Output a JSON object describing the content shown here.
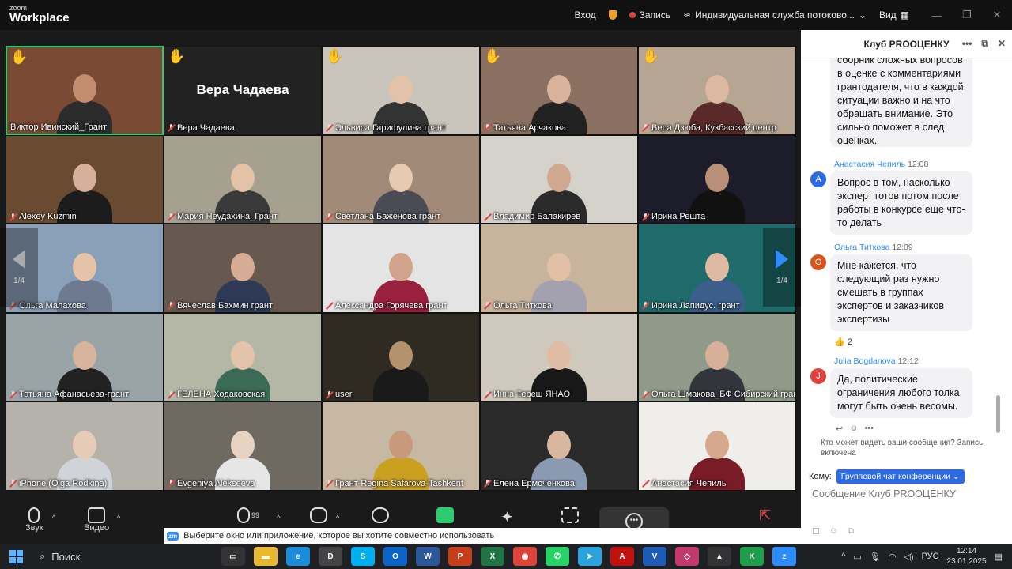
{
  "window": {
    "logo_top": "zoom",
    "logo_bottom": "Workplace",
    "signin": "Вход",
    "record": "Запись",
    "stream": "Индивидуальная служба потоково...",
    "view": "Вид"
  },
  "participants": [
    {
      "name": "Виктор Ивинский_Грант",
      "hand": true,
      "active": true,
      "muted": false,
      "bg": "#7a4a35",
      "skin": "#c28d6e",
      "shirt": "#2c2c2c"
    },
    {
      "name": "Вера Чадаева",
      "hand": true,
      "muted": true,
      "bg": "#222222",
      "big": "Вера Чадаева"
    },
    {
      "name": "Эльвира Гарифулина грант",
      "hand": true,
      "muted": true,
      "bg": "#c9c4bc",
      "skin": "#e2c2a8",
      "shirt": "#333333"
    },
    {
      "name": "Татьяна Арчакова",
      "hand": true,
      "muted": true,
      "bg": "#8a7060",
      "skin": "#d9b39a",
      "shirt": "#222222"
    },
    {
      "name": "Вера Дзюба, Кузбасский центр",
      "hand": true,
      "muted": true,
      "bg": "#b7a593",
      "skin": "#dcb8a0",
      "shirt": "#5a2a2a"
    },
    {
      "name": "Alexey Kuzmin",
      "muted": true,
      "bg": "#6a4a30",
      "skin": "#d6b09a",
      "shirt": "#1c1c1c"
    },
    {
      "name": "Мария Неудахина_Грант",
      "muted": true,
      "bg": "#a5a090",
      "skin": "#e3c2a6",
      "shirt": "#3a3a3a"
    },
    {
      "name": "Светлана Баженова грант",
      "muted": true,
      "bg": "#a18a78",
      "skin": "#e7cbb0",
      "shirt": "#4b4b55"
    },
    {
      "name": "Владимир Балакирев",
      "muted": true,
      "bg": "#d5d2cc",
      "skin": "#d1a890",
      "shirt": "#2a2a2a"
    },
    {
      "name": "Ирина Решта",
      "muted": true,
      "bg": "#1c1c2a",
      "skin": "#b98f78",
      "shirt": "#111111"
    },
    {
      "name": "Ольга Малахова",
      "muted": true,
      "bg": "#8aa0b8",
      "skin": "#e4c3a8",
      "shirt": "#6d7a90"
    },
    {
      "name": "Вячеслав Бахмин грант",
      "muted": true,
      "bg": "#675850",
      "skin": "#d8ab95",
      "shirt": "#2e3a55"
    },
    {
      "name": "Александра Горячева грант",
      "muted": true,
      "bg": "#e4e4e4",
      "skin": "#cfa48b",
      "shirt": "#9a2040"
    },
    {
      "name": "Ольга Титкова",
      "muted": true,
      "bg": "#c8b49c",
      "skin": "#e2c0a5",
      "shirt": "#a3a0b0"
    },
    {
      "name": "Ирина Лапидус. грант",
      "muted": true,
      "bg": "#1f6a6a",
      "skin": "#dcbba2",
      "shirt": "#3b5f8a"
    },
    {
      "name": "Татьяна Афанасьева-грант",
      "muted": true,
      "bg": "#9aa4a8",
      "skin": "#d7b49c",
      "shirt": "#222222"
    },
    {
      "name": "ГЕЛЕНА Ходаковская",
      "muted": true,
      "bg": "#b5b7a6",
      "skin": "#e3c4aa",
      "shirt": "#3b6a55"
    },
    {
      "name": "user",
      "muted": true,
      "bg": "#2f2a22",
      "skin": "#b5926e",
      "shirt": "#1a1a1a"
    },
    {
      "name": "Инна Тереш ЯНАО",
      "muted": true,
      "bg": "#cfc8bd",
      "skin": "#e0bca4",
      "shirt": "#181818"
    },
    {
      "name": "Ольга Шмакова_БФ Сибирский грант",
      "muted": true,
      "bg": "#8f9a88",
      "skin": "#d8b09a",
      "shirt": "#33353d"
    },
    {
      "name": "iPhone (Olga Rodkina)",
      "muted": true,
      "bg": "#b5b1ab",
      "skin": "#e6ccb8",
      "shirt": "#d0d4d8"
    },
    {
      "name": "Evgeniya Alekseeva",
      "muted": true,
      "bg": "#6e6a62",
      "skin": "#e8d2c2",
      "shirt": "#e6e6e6"
    },
    {
      "name": "Грант-Regina Safarova-Tashkent",
      "muted": true,
      "bg": "#c7b8a3",
      "skin": "#c9997e",
      "shirt": "#c9a020"
    },
    {
      "name": "Елена Ермоченкова",
      "muted": true,
      "bg": "#2a2a2a",
      "skin": "#d9b79f",
      "shirt": "#8a9ab0"
    },
    {
      "name": "Анастасия Чепиль",
      "muted": true,
      "bg": "#f0eeea",
      "skin": "#d6a98e",
      "shirt": "#7a1c28"
    }
  ],
  "pager": {
    "left": "1/4",
    "right": "1/4"
  },
  "toolbar": {
    "audio": "Звук",
    "video": "Видео",
    "participants_count": "99"
  },
  "sharebar": {
    "text": "Выберите окно или приложение, которое вы хотите совместно использовать"
  },
  "chat": {
    "title": "Клуб PROОЦЕНКУ",
    "msg0": "сборник сложных вопросов в оценке с комментариями грантодателя, что в каждой ситуации важно и на что обращать внимание. Это сильно поможет в след оценках.",
    "m1_name": "Анастасия Чепиль",
    "m1_time": "12:08",
    "m1_initial": "А",
    "m1_text": "Вопрос в том, насколько эксперт готов потом после работы в конкурсе еще что-то делать",
    "m2_name": "Ольга Титкова",
    "m2_time": "12:09",
    "m2_initial": "О",
    "m2_text": "Мне кажется, что следующий раз нужно смешать в группах экспертов и заказчиков экспертизы",
    "m2_reaction": "👍 2",
    "m3_name": "Julia Bogdanova",
    "m3_time": "12:12",
    "m3_initial": "J",
    "m3_text": "Да, политические ограничения любого толка могут быть очень весомы.",
    "who_can_see": "Кто может видеть ваши сообщения? Запись включена",
    "to_label": "Кому:",
    "to_value": "Групповой чат конференции",
    "placeholder": "Сообщение Клуб PROОЦЕНКУ",
    "colors": {
      "m1": "#2d6be5",
      "m2": "#d9541a",
      "m3": "#e2423f"
    }
  },
  "taskbar": {
    "search": "Поиск",
    "lang": "РУС",
    "time": "12:14",
    "date": "23.01.2025"
  }
}
